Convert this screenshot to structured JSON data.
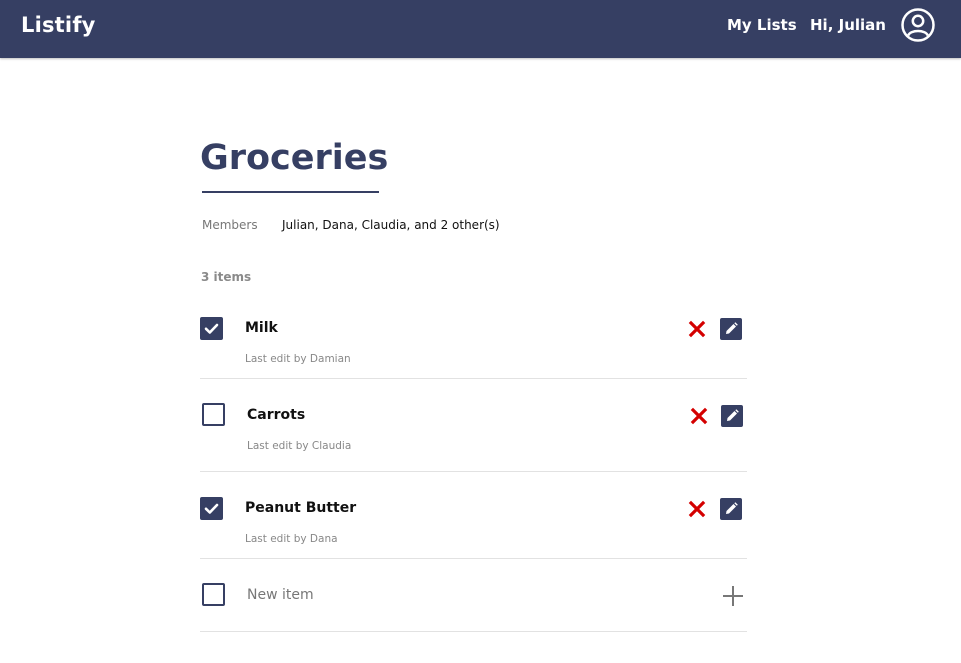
{
  "app": {
    "brand": "Listify",
    "nav": {
      "my_lists": "My Lists",
      "greeting": "Hi, Julian"
    },
    "colors": {
      "primary": "#363f63",
      "delete": "#d40000",
      "muted": "#888888"
    }
  },
  "list": {
    "title": "Groceries",
    "members_label": "Members",
    "members_value": "Julian, Dana, Claudia, and 2 other(s)",
    "item_count": "3 items",
    "items": [
      {
        "name": "Milk",
        "meta": "Last edit by Damian",
        "checked": true
      },
      {
        "name": "Carrots",
        "meta": "Last edit by Claudia",
        "checked": false
      },
      {
        "name": "Peanut Butter",
        "meta": "Last edit by Dana",
        "checked": true
      }
    ],
    "new_item": {
      "placeholder": "New item",
      "value": ""
    }
  },
  "icons": {
    "avatar": "user-circle-icon",
    "checked": "checkbox-checked-icon",
    "unchecked": "checkbox-unchecked-icon",
    "delete": "x-icon",
    "edit": "pencil-icon",
    "add": "plus-icon"
  }
}
